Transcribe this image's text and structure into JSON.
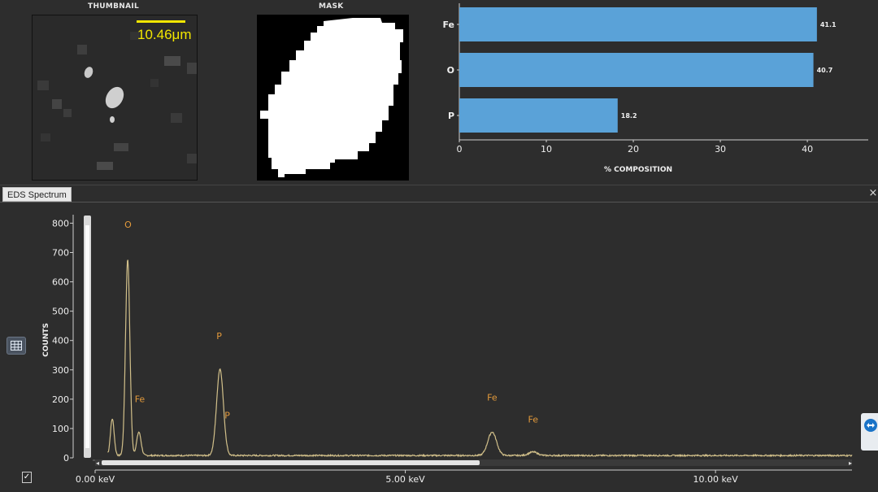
{
  "thumbnail": {
    "caption": "THUMBNAIL",
    "scale_label": "10.46μm"
  },
  "mask": {
    "caption": "MASK"
  },
  "composition": {
    "xlabel": "% COMPOSITION",
    "colors": {
      "bar": "#5aa2d8",
      "axis": "#cfcfcf"
    },
    "chart_data": {
      "type": "bar",
      "orientation": "horizontal",
      "categories": [
        "Fe",
        "O",
        "P"
      ],
      "values": [
        41.1,
        40.7,
        18.2
      ],
      "value_labels": [
        "41.1",
        "40.7",
        "18.2"
      ],
      "xticks": [
        0,
        10,
        20,
        30,
        40
      ],
      "xlim": [
        0,
        47
      ],
      "xlabel": "% COMPOSITION"
    }
  },
  "spectrum": {
    "tab_label": "EDS Spectrum",
    "close_label": "×",
    "ylabel": "COUNTS",
    "colors": {
      "line": "#d2c08a",
      "peak_label": "#e39a3b",
      "axis": "#cfcfcf"
    },
    "chart_data": {
      "type": "line",
      "xlabel": "",
      "ylabel": "COUNTS",
      "xlim": [
        0,
        12.2
      ],
      "ylim": [
        0,
        840
      ],
      "yticks": [
        0,
        100,
        200,
        300,
        400,
        500,
        600,
        700,
        800
      ],
      "xticks": [
        {
          "value": 0,
          "label": "0.00 keV"
        },
        {
          "value": 5,
          "label": "5.00 keV"
        },
        {
          "value": 10,
          "label": "10.00 keV"
        }
      ],
      "background_counts": 8,
      "peaks": [
        {
          "energy": 0.277,
          "counts": 125,
          "width": 0.03
        },
        {
          "energy": 0.525,
          "counts": 670,
          "width": 0.035
        },
        {
          "energy": 0.705,
          "counts": 80,
          "width": 0.035
        },
        {
          "energy": 2.013,
          "counts": 295,
          "width": 0.055
        },
        {
          "energy": 6.4,
          "counts": 80,
          "width": 0.07
        },
        {
          "energy": 7.06,
          "counts": 12,
          "width": 0.07
        }
      ],
      "annotations": [
        {
          "label": "O",
          "energy": 0.53,
          "counts": 785
        },
        {
          "label": "Fe",
          "energy": 0.72,
          "counts": 190
        },
        {
          "label": "P",
          "energy": 2.0,
          "counts": 405
        },
        {
          "label": "P",
          "energy": 2.13,
          "counts": 135
        },
        {
          "label": "Fe",
          "energy": 6.4,
          "counts": 195
        },
        {
          "label": "Fe",
          "energy": 7.06,
          "counts": 120
        }
      ]
    }
  },
  "controls": {
    "check_mark": "✓"
  }
}
